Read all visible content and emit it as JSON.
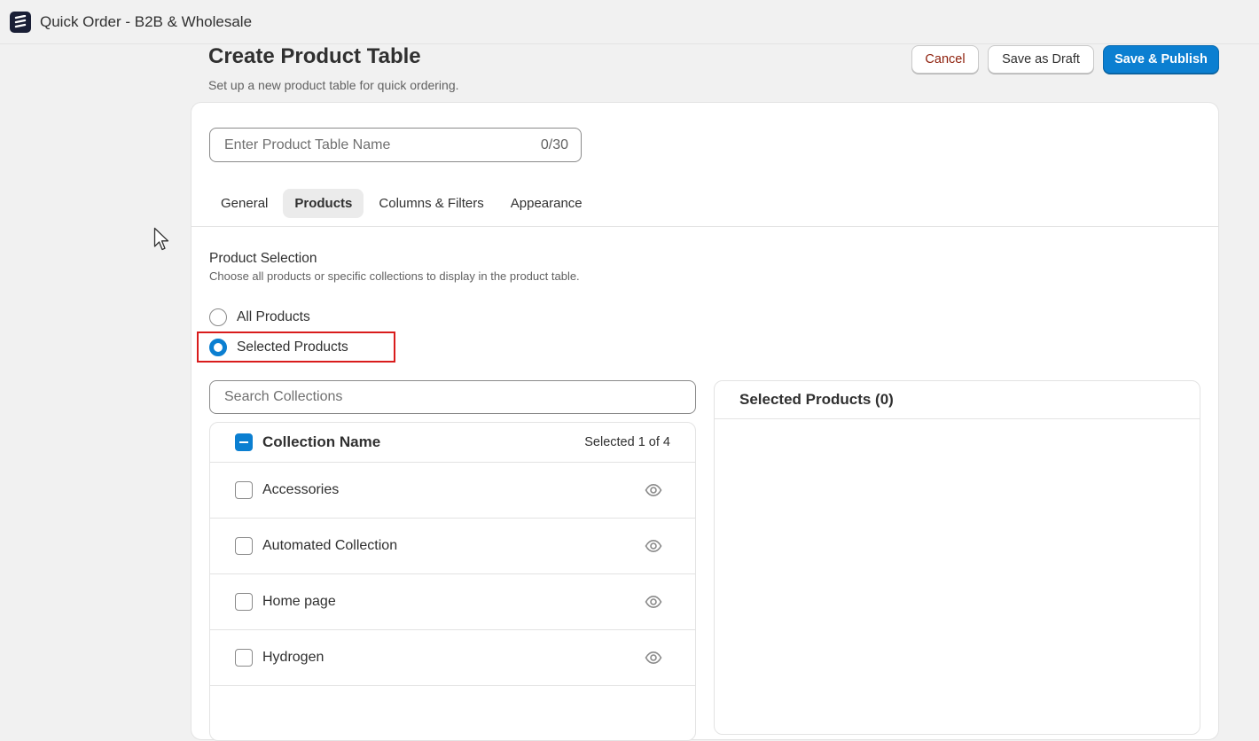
{
  "app": {
    "title": "Quick Order - B2B & Wholesale",
    "logo_icon": "app-logo-icon"
  },
  "header": {
    "title": "Create Product Table",
    "subtitle": "Set up a new product table for quick ordering.",
    "cancel_label": "Cancel",
    "draft_label": "Save as Draft",
    "publish_label": "Save & Publish"
  },
  "form": {
    "name_placeholder": "Enter Product Table Name",
    "name_value": "",
    "name_count": "0/30"
  },
  "tabs": [
    {
      "label": "General",
      "active": false
    },
    {
      "label": "Products",
      "active": true
    },
    {
      "label": "Columns & Filters",
      "active": false
    },
    {
      "label": "Appearance",
      "active": false
    }
  ],
  "product_selection": {
    "title": "Product Selection",
    "description": "Choose all products or specific collections to display in the product table.",
    "options": [
      {
        "label": "All Products",
        "checked": false
      },
      {
        "label": "Selected Products",
        "checked": true
      }
    ]
  },
  "collections": {
    "search_placeholder": "Search Collections",
    "header_label": "Collection Name",
    "selected_count": "Selected 1 of 4",
    "items": [
      {
        "label": "Accessories",
        "checked": false
      },
      {
        "label": "Automated Collection",
        "checked": false
      },
      {
        "label": "Home page",
        "checked": false
      },
      {
        "label": "Hydrogen",
        "checked": false
      }
    ]
  },
  "selected_products": {
    "header": "Selected Products (0)"
  },
  "colors": {
    "primary": "#0b7fd1",
    "cancel_text": "#8e1f0b",
    "highlight": "#d91c1c",
    "background": "#f1f1f1"
  }
}
